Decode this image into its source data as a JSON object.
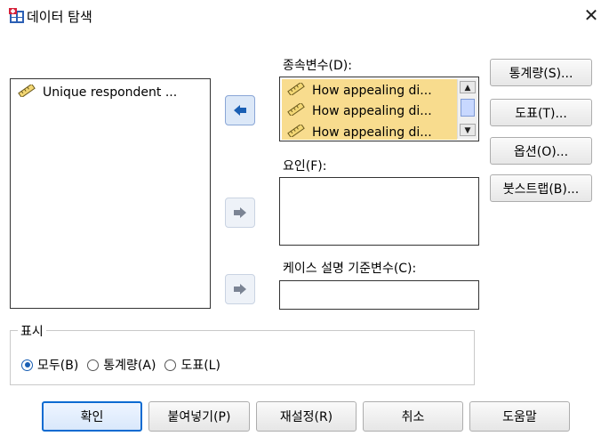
{
  "window": {
    "title": "데이터 탐색",
    "close_glyph": "✕"
  },
  "source_list": {
    "items": [
      "Unique respondent ..."
    ]
  },
  "dependent": {
    "label": "종속변수(D):",
    "items": [
      "How appealing di...",
      "How appealing di...",
      "How appealing di..."
    ]
  },
  "factor": {
    "label": "요인(F):"
  },
  "case_label": {
    "label": "케이스 설명 기준변수(C):"
  },
  "side_buttons": {
    "stats": "통계량(S)...",
    "plots": "도표(T)...",
    "options": "옵션(O)...",
    "bootstrap": "붓스트랩(B)..."
  },
  "display": {
    "legend": "표시",
    "options": [
      {
        "label": "모두(B)",
        "selected": true
      },
      {
        "label": "통계량(A)",
        "selected": false
      },
      {
        "label": "도표(L)",
        "selected": false
      }
    ]
  },
  "bottom_buttons": {
    "ok": "확인",
    "paste": "붙여넣기(P)",
    "reset": "재설정(R)",
    "cancel": "취소",
    "help": "도움말"
  },
  "colors": {
    "accent": "#0c6bd1",
    "selection": "#f8dc8e",
    "arrow_active": "#1a5fb4"
  }
}
